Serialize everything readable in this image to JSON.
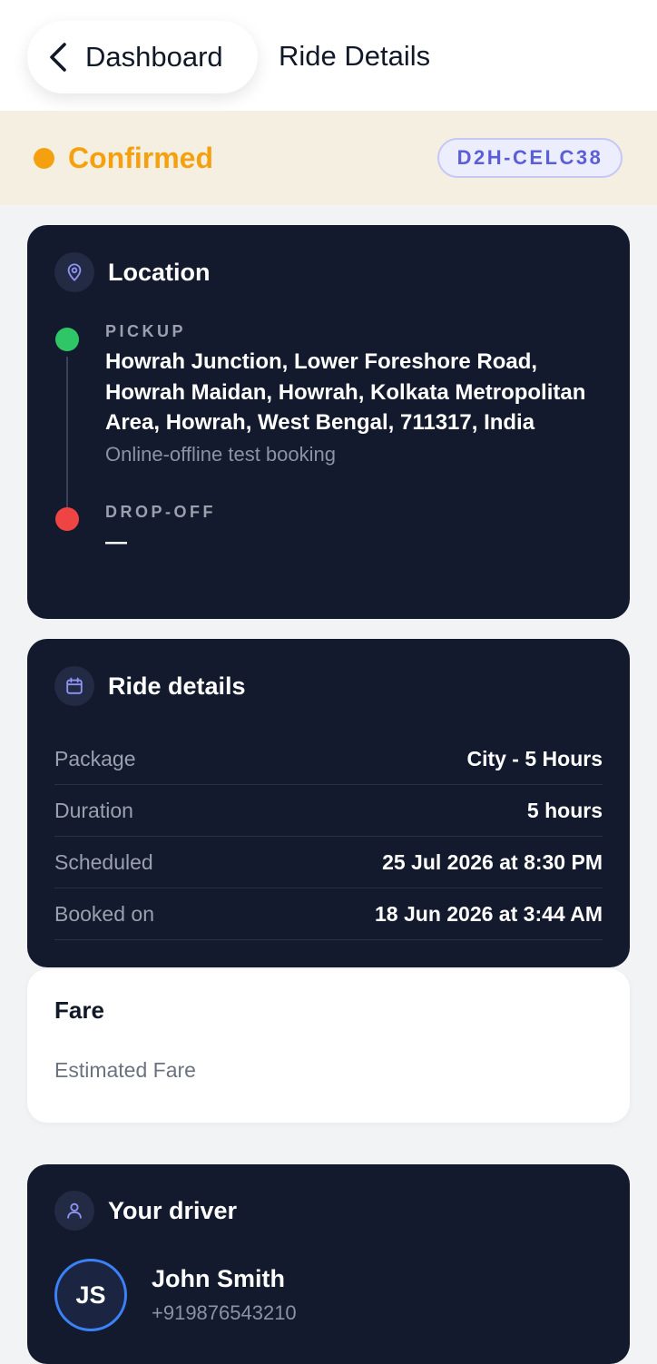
{
  "header": {
    "back_label": "Dashboard",
    "title": "Ride Details"
  },
  "status": {
    "label": "Confirmed",
    "color": "#f5a10f",
    "booking_id": "D2H-CELC38"
  },
  "location": {
    "title": "Location",
    "pickup_label": "PICKUP",
    "pickup_address": "Howrah Junction, Lower Foreshore Road, Howrah Maidan, Howrah, Kolkata Metropolitan Area, Howrah, West Bengal, 711317, India",
    "pickup_note": "Online-offline test booking",
    "dropoff_label": "DROP-OFF",
    "dropoff_value": "—"
  },
  "ride_details": {
    "title": "Ride details",
    "rows": [
      {
        "key": "Package",
        "value": "City - 5 Hours"
      },
      {
        "key": "Duration",
        "value": "5 hours"
      },
      {
        "key": "Scheduled",
        "value": "25 Jul 2026 at 8:30 PM"
      },
      {
        "key": "Booked on",
        "value": "18 Jun 2026 at 3:44 AM"
      }
    ]
  },
  "fare": {
    "title": "Fare",
    "estimated_label": "Estimated Fare"
  },
  "driver": {
    "title": "Your driver",
    "initials": "JS",
    "name": "John Smith",
    "phone": "+919876543210"
  },
  "icons": {
    "back": "chevron-left-icon",
    "location": "map-pin-icon",
    "ride_details": "calendar-icon",
    "driver": "user-icon"
  }
}
